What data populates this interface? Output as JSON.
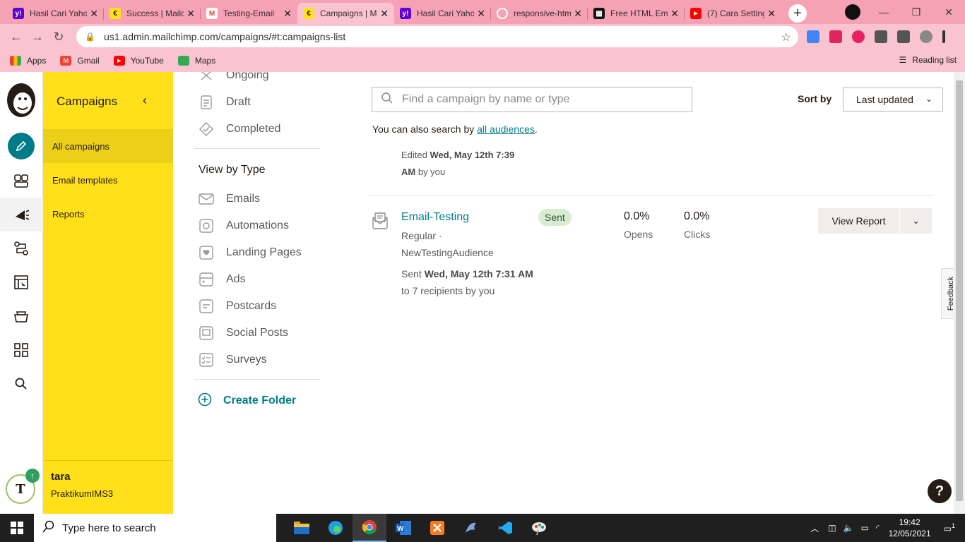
{
  "browser": {
    "tabs": [
      {
        "label": "Hasil Cari Yahoo",
        "icon": "yahoo-icon",
        "color": "#6001d2",
        "glyph": "y!"
      },
      {
        "label": "Success | Mailchimp",
        "icon": "mailchimp-icon",
        "color": "#ffe01b",
        "glyph": "€"
      },
      {
        "label": "Testing-Email",
        "icon": "gmail-icon",
        "color": "#ffffff",
        "glyph": "M"
      },
      {
        "label": "Campaigns | Mailchimp",
        "icon": "mailchimp-icon",
        "color": "#ffe01b",
        "glyph": "€"
      },
      {
        "label": "Hasil Cari Yahoo",
        "icon": "yahoo-icon",
        "color": "#6001d2",
        "glyph": "y!"
      },
      {
        "label": "responsive-html",
        "icon": "github-icon",
        "color": "#f5a3b4",
        "glyph": "◯"
      },
      {
        "label": "Free HTML Email",
        "icon": "site-icon",
        "color": "#111111",
        "glyph": "▦"
      },
      {
        "label": "(7) Cara Setting",
        "icon": "youtube-icon",
        "color": "#ff0000",
        "glyph": "▶"
      }
    ],
    "url": "us1.admin.mailchimp.com/campaigns/#t:campaigns-list",
    "bookmarks": [
      {
        "label": "Apps",
        "icon": "apps-grid-icon",
        "color": "#4285f4"
      },
      {
        "label": "Gmail",
        "icon": "gmail-icon",
        "color": "#ea4335"
      },
      {
        "label": "YouTube",
        "icon": "youtube-icon",
        "color": "#ff0000"
      },
      {
        "label": "Maps",
        "icon": "maps-icon",
        "color": "#34a853"
      }
    ],
    "reading_list": "Reading list"
  },
  "sidebar": {
    "title": "Campaigns",
    "items": [
      {
        "label": "All campaigns",
        "selected": true
      },
      {
        "label": "Email templates",
        "selected": false
      },
      {
        "label": "Reports",
        "selected": false
      }
    ],
    "account": {
      "user": "tara",
      "org": "PraktikumIMS3",
      "avatar_letter": "T"
    }
  },
  "folders": {
    "status_items": [
      {
        "label": "Ongoing",
        "icon": "ongoing-icon"
      },
      {
        "label": "Draft",
        "icon": "draft-icon"
      },
      {
        "label": "Completed",
        "icon": "completed-icon"
      }
    ],
    "type_heading": "View by Type",
    "type_items": [
      {
        "label": "Emails",
        "icon": "email-icon"
      },
      {
        "label": "Automations",
        "icon": "automation-icon"
      },
      {
        "label": "Landing Pages",
        "icon": "landing-page-icon"
      },
      {
        "label": "Ads",
        "icon": "ads-icon"
      },
      {
        "label": "Postcards",
        "icon": "postcard-icon"
      },
      {
        "label": "Social Posts",
        "icon": "social-post-icon"
      },
      {
        "label": "Surveys",
        "icon": "survey-icon"
      }
    ],
    "create_folder": "Create Folder"
  },
  "main": {
    "search_placeholder": "Find a campaign by name or type",
    "hint_prefix": "You can also search by ",
    "hint_link": "all audiences",
    "hint_suffix": ".",
    "sort_label": "Sort by",
    "sort_value": "Last updated",
    "prev_row": {
      "edited_prefix": "Edited",
      "edited_date": "Wed, May 12th 7:39",
      "edited_time": "AM",
      "edited_suffix": "by you"
    },
    "campaign": {
      "name": "Email-Testing",
      "type": "Regular ·",
      "audience": "NewTestingAudience",
      "status": "Sent",
      "sent_prefix": "Sent",
      "sent_date": "Wed, May 12th 7:31 AM",
      "sent_suffix": "to 7 recipients by you",
      "opens_value": "0.0%",
      "opens_label": "Opens",
      "clicks_value": "0.0%",
      "clicks_label": "Clicks",
      "view_report": "View Report"
    },
    "feedback": "Feedback",
    "help": "?"
  },
  "taskbar": {
    "search_placeholder": "Type here to search",
    "time": "19:42",
    "date": "12/05/2021",
    "notifications": "1"
  },
  "colors": {
    "brand_yellow": "#ffe01b",
    "teal": "#007c89",
    "chrome_pink": "#f5a3b4"
  }
}
